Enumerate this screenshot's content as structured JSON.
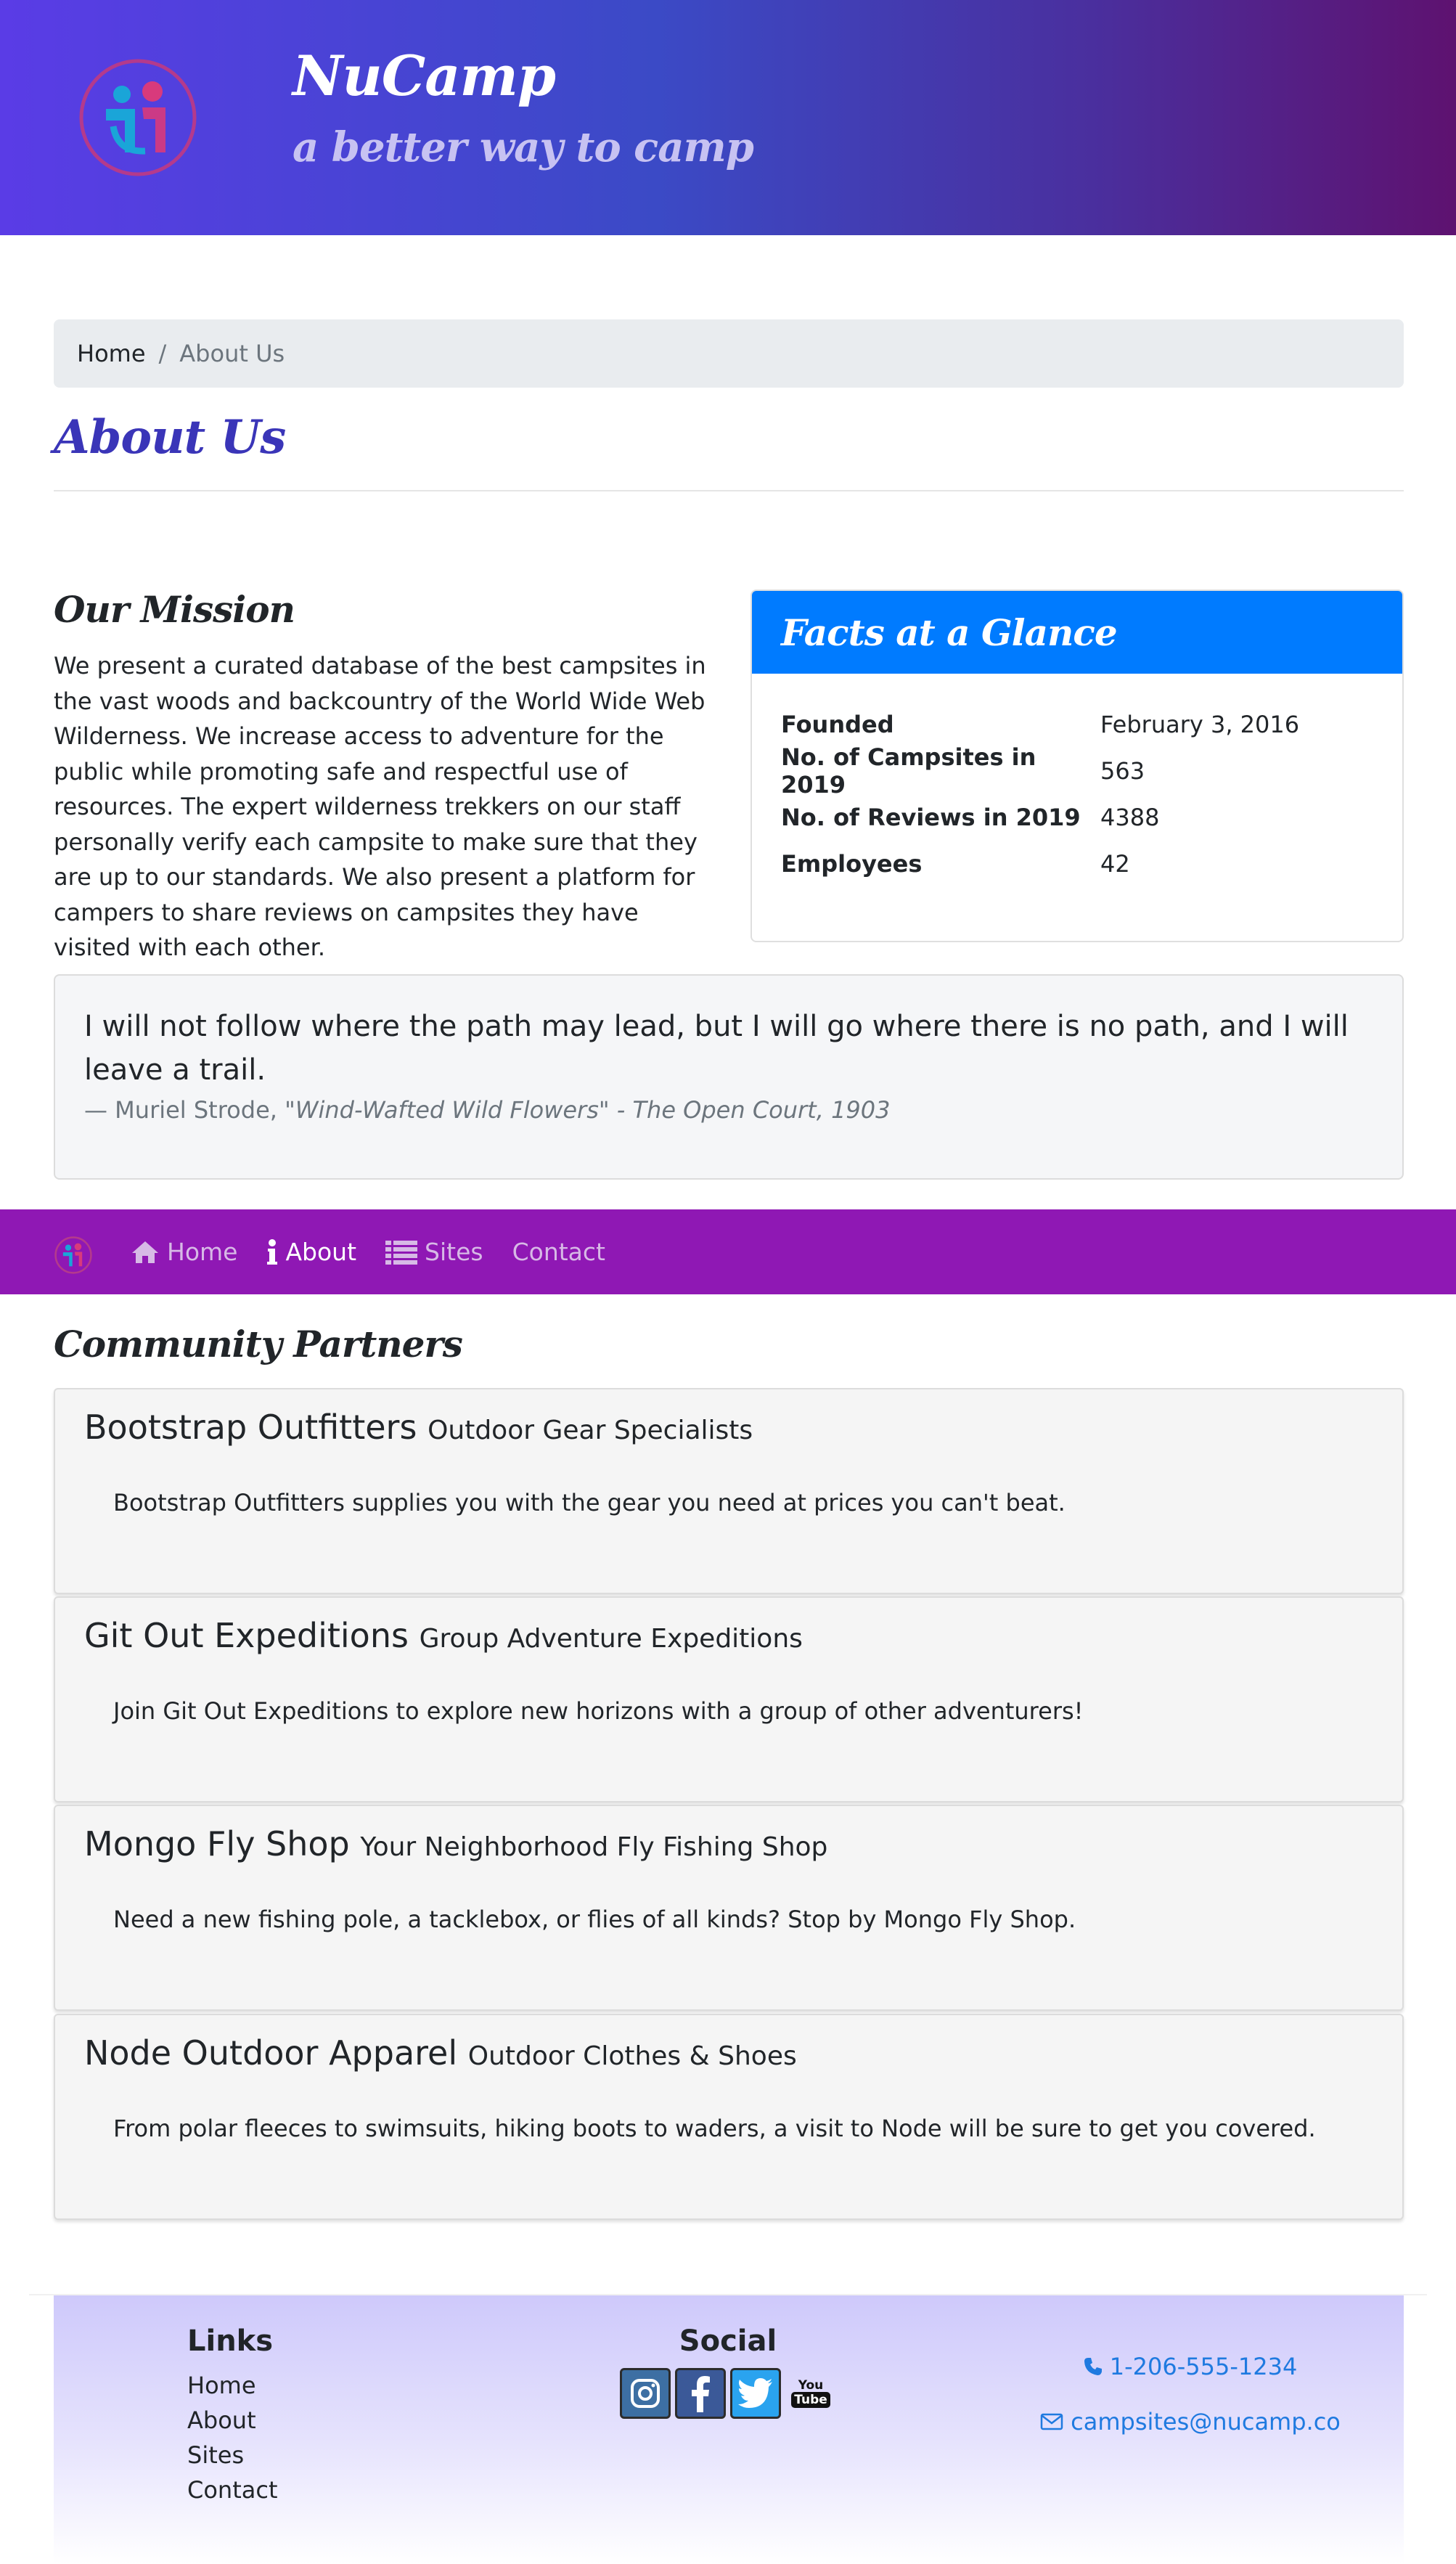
{
  "header": {
    "brand_title": "NuCamp",
    "tagline": "a better way to camp"
  },
  "breadcrumb": {
    "home": "Home",
    "separator": "/",
    "active": "About Us"
  },
  "page_title": "About Us",
  "mission": {
    "title": "Our Mission",
    "text": "We present a curated database of the best campsites in the vast woods and backcountry of the World Wide Web Wilderness. We increase access to adventure for the public while promoting safe and respectful use of resources. The expert wilderness trekkers on our staff personally verify each campsite to make sure that they are up to our standards. We also present a platform for campers to share reviews on campsites they have visited with each other."
  },
  "facts": {
    "title": "Facts at a Glance",
    "rows": [
      {
        "label": "Founded",
        "value": "February 3, 2016"
      },
      {
        "label": "No. of Campsites in 2019",
        "value": "563"
      },
      {
        "label": "No. of Reviews in 2019",
        "value": "4388"
      },
      {
        "label": "Employees",
        "value": "42"
      }
    ]
  },
  "quote": {
    "text": "I will not follow where the path may lead, but I will go where there is no path, and I will leave a trail.",
    "author": "— Muriel Strode,",
    "source": "\"Wind-Wafted Wild Flowers\" - The Open Court, 1903"
  },
  "navbar": {
    "items": [
      {
        "label": "Home",
        "icon": "home-icon"
      },
      {
        "label": "About",
        "icon": "info-icon"
      },
      {
        "label": "Sites",
        "icon": "list-icon"
      },
      {
        "label": "Contact",
        "icon": ""
      }
    ],
    "active_color": "#ffffff",
    "inactive_color": "#d7b9e6",
    "background": "#8f18b4"
  },
  "partners": {
    "title": "Community Partners",
    "items": [
      {
        "name": "Bootstrap Outfitters",
        "subtitle": "Outdoor Gear Specialists",
        "description": "Bootstrap Outfitters supplies you with the gear you need at prices you can't beat."
      },
      {
        "name": "Git Out Expeditions",
        "subtitle": "Group Adventure Expeditions",
        "description": "Join Git Out Expeditions to explore new horizons with a group of other adventurers!"
      },
      {
        "name": "Mongo Fly Shop",
        "subtitle": "Your Neighborhood Fly Fishing Shop",
        "description": "Need a new fishing pole, a tacklebox, or flies of all kinds? Stop by Mongo Fly Shop."
      },
      {
        "name": "Node Outdoor Apparel",
        "subtitle": "Outdoor Clothes & Shoes",
        "description": "From polar fleeces to swimsuits, hiking boots to waders, a visit to Node will be sure to get you covered."
      }
    ]
  },
  "footer": {
    "links_heading": "Links",
    "links": [
      "Home",
      "About",
      "Sites",
      "Contact"
    ],
    "social_heading": "Social",
    "social_icons": [
      "instagram-icon",
      "facebook-icon",
      "twitter-icon",
      "youtube-icon"
    ],
    "youtube_text_top": "You",
    "youtube_text_bottom": "Tube",
    "phone": "1-206-555-1234",
    "email": "campsites@nucamp.co"
  },
  "colors": {
    "header_gradient_start": "#5a3ce6",
    "header_gradient_end": "#5e1270",
    "title_blue": "#3a35b8",
    "facts_header": "#007bff",
    "link_blue": "#1f7ae0"
  }
}
